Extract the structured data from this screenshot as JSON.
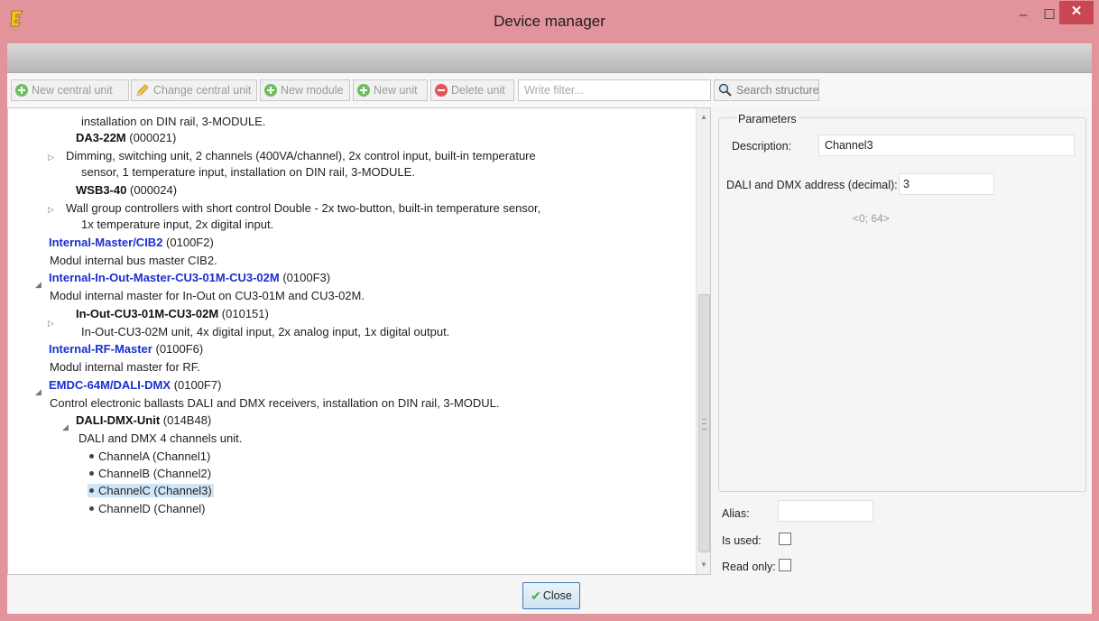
{
  "window": {
    "title": "Device manager",
    "minimize": "–",
    "maximize": "☐",
    "close": "✕"
  },
  "toolbar": {
    "new_central_unit": "New central unit",
    "change_central_unit": "Change central unit",
    "new_module": "New module",
    "new_unit": "New unit",
    "delete_unit": "Delete unit",
    "filter_placeholder": "Write filter...",
    "search_structure": "Search structure"
  },
  "tree": {
    "r1": "installation on DIN rail, 3-MODULE.",
    "r2_name": "DA3-22M",
    "r2_code": "(000021)",
    "r3": "Dimming, switching unit, 2 channels (400VA/channel), 2x control input, built-in temperature",
    "r4": "sensor, 1 temperature input, installation on DIN rail, 3-MODULE.",
    "r5_name": "WSB3-40",
    "r5_code": "(000024)",
    "r6": "Wall group controllers with short control Double - 2x two-button, built-in temperature sensor,",
    "r7": "1x temperature input, 2x digital input.",
    "r8_name": "Internal-Master/CIB2",
    "r8_code": "(0100F2)",
    "r9": "Modul internal bus master CIB2.",
    "r10_name": "Internal-In-Out-Master-CU3-01M-CU3-02M",
    "r10_code": "(0100F3)",
    "r11": "Modul internal master for In-Out on CU3-01M and CU3-02M.",
    "r12_name": "In-Out-CU3-01M-CU3-02M",
    "r12_code": "(010151)",
    "r13": "In-Out-CU3-02M unit, 4x digital input, 2x analog input, 1x digital output.",
    "r14_name": "Internal-RF-Master",
    "r14_code": "(0100F6)",
    "r15": "Modul internal master for RF.",
    "r16_name": "EMDC-64M/DALI-DMX",
    "r16_code": "(0100F7)",
    "r17": "Control electronic ballasts DALI and DMX receivers, installation on DIN rail, 3-MODUL.",
    "r18_name": "DALI-DMX-Unit",
    "r18_code": "(014B48)",
    "r19": "DALI and DMX 4 channels unit.",
    "channels": [
      "ChannelA (Channel1)",
      "ChannelB (Channel2)",
      "ChannelC (Channel3)",
      "ChannelD (Channel)"
    ]
  },
  "params": {
    "legend": "Parameters",
    "description_label": "Description:",
    "description_value": "Channel3",
    "address_label": "DALI and DMX address (decimal):",
    "address_value": "3",
    "address_range": "<0; 64>",
    "alias_label": "Alias:",
    "alias_value": "",
    "is_used_label": "Is used:",
    "read_only_label": "Read only:"
  },
  "footer": {
    "close_label": "Close"
  },
  "colors": {
    "title_bar": "#e3939c",
    "close_button": "#c94653",
    "link_blue": "#1a2fd0",
    "selection": "#cfe6f8"
  }
}
